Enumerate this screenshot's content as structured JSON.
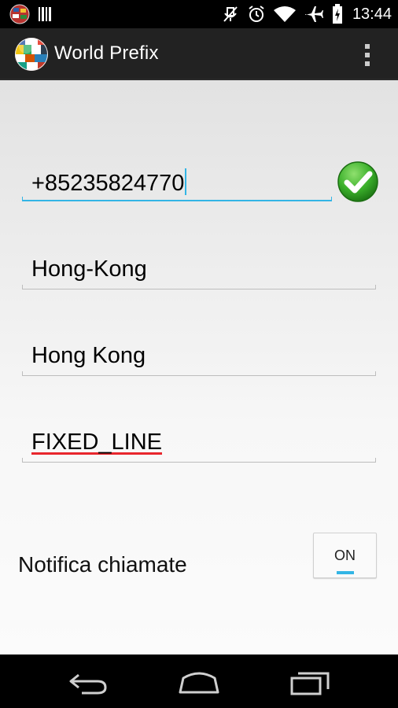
{
  "status_bar": {
    "time": "13:44",
    "icons": [
      "app-flags-icon",
      "barcode-icon",
      "mute-icon",
      "alarm-icon",
      "wifi-icon",
      "airplane-icon",
      "battery-icon"
    ]
  },
  "action_bar": {
    "title": "World Prefix",
    "overflow_icon": "overflow-menu-icon"
  },
  "form": {
    "phone_number": "+85235824770",
    "region": "Hong-Kong",
    "country": "Hong Kong",
    "line_type": "FIXED_LINE",
    "submit_icon": "checkmark-icon"
  },
  "setting": {
    "label": "Notifica chiamate",
    "toggle_state": "ON",
    "accent": "#33b5e5"
  },
  "nav_bar": {
    "buttons": [
      "back-icon",
      "home-icon",
      "recent-apps-icon"
    ]
  },
  "colors": {
    "accent": "#33b5e5",
    "spell_underline": "#e8262d",
    "check_green": "#3bb02b"
  }
}
